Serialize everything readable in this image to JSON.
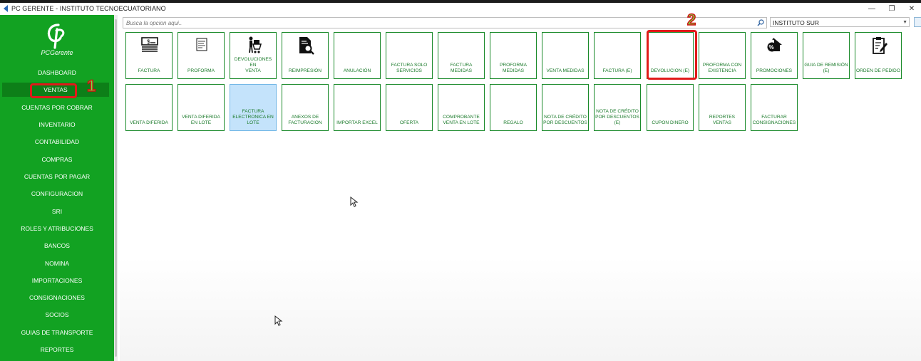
{
  "window": {
    "title": "PC GERENTE - INSTITUTO TECNOECUATORIANO",
    "controls": [
      "minimize-icon",
      "restore-icon",
      "close-icon"
    ]
  },
  "sidebar": {
    "logo_text": "PCGerente",
    "items": [
      {
        "label": "DASHBOARD",
        "active": false
      },
      {
        "label": "VENTAS",
        "active": true
      },
      {
        "label": "CUENTAS POR COBRAR",
        "active": false
      },
      {
        "label": "INVENTARIO",
        "active": false
      },
      {
        "label": "CONTABILIDAD",
        "active": false
      },
      {
        "label": "COMPRAS",
        "active": false
      },
      {
        "label": "CUENTAS POR PAGAR",
        "active": false
      },
      {
        "label": "CONFIGURACION",
        "active": false
      },
      {
        "label": "SRI",
        "active": false
      },
      {
        "label": "ROLES Y ATRIBUCIONES",
        "active": false
      },
      {
        "label": "BANCOS",
        "active": false
      },
      {
        "label": "NOMINA",
        "active": false
      },
      {
        "label": "IMPORTACIONES",
        "active": false
      },
      {
        "label": "CONSIGNACIONES",
        "active": false
      },
      {
        "label": "SOCIOS",
        "active": false
      },
      {
        "label": "GUIAS DE TRANSPORTE",
        "active": false
      },
      {
        "label": "REPORTES",
        "active": false
      }
    ]
  },
  "toolbar": {
    "search_placeholder": "Busca la opcion aqui..",
    "branch": "INSTITUTO SUR"
  },
  "tiles_row1": [
    {
      "label": "FACTURA",
      "icon": "invoice-icon"
    },
    {
      "label": "PROFORMA",
      "icon": "proforma-icon"
    },
    {
      "label": "DEVOLUCIONES EN\nVENTA",
      "icon": "return-cart-icon"
    },
    {
      "label": "REIMPRESIÓN",
      "icon": "document-search-icon"
    },
    {
      "label": "ANULACIÓN",
      "icon": ""
    },
    {
      "label": "FACTURA SOLO\nSERVICIOS",
      "icon": ""
    },
    {
      "label": "FACTURA MEDIDAS",
      "icon": ""
    },
    {
      "label": "PROFORMA\nMEDIDAS",
      "icon": ""
    },
    {
      "label": "VENTA MEDIDAS",
      "icon": ""
    },
    {
      "label": "FACTURA (E)",
      "icon": ""
    },
    {
      "label": "DEVOLUCION (E)",
      "icon": ""
    },
    {
      "label": "PROFORMA CON\nEXISTENCIA",
      "icon": ""
    },
    {
      "label": "PROMOCIONES",
      "icon": "promotion-house-icon"
    },
    {
      "label": "GUIA DE REMISIÓN\n(E)",
      "icon": ""
    },
    {
      "label": "ORDEN DE PEDIDO",
      "icon": "clipboard-edit-icon"
    }
  ],
  "tiles_row2": [
    {
      "label": "VENTA DIFERIDA",
      "selected": false
    },
    {
      "label": "VENTA DIFERIDA\nEN LOTE",
      "selected": false
    },
    {
      "label": "FACTURA\nELECTRONICA EN\nLOTE",
      "selected": true
    },
    {
      "label": "ANEXOS DE\nFACTURACION",
      "selected": false
    },
    {
      "label": "IMPORTAR EXCEL",
      "selected": false
    },
    {
      "label": "OFERTA",
      "selected": false
    },
    {
      "label": "COMPROBANTE\nVENTA EN LOTE",
      "selected": false
    },
    {
      "label": "REGALO",
      "selected": false
    },
    {
      "label": "NOTA DE CRÉDITO\nPOR DESCUENTOS",
      "selected": false
    },
    {
      "label": "NOTA DE CRÉDITO\nPOR DESCUENTOS\n(E)",
      "selected": false
    },
    {
      "label": "CUPON DINERO",
      "selected": false
    },
    {
      "label": "REPORTES VENTAS",
      "selected": false
    },
    {
      "label": "FACTURAR\nCONSIGNACIONES",
      "selected": false
    }
  ],
  "annotations": [
    {
      "number": "1",
      "target": "VENTAS",
      "color": "#e11a1a"
    },
    {
      "number": "2",
      "target": "DEVOLUCION (E)",
      "color": "#e11a1a"
    }
  ],
  "colors": {
    "sidebar": "#12a222",
    "sidebar_active": "#0d7f18",
    "tile_border": "#1a8a2a",
    "tile_text": "#1a7a2a",
    "tile_selected": "#c4e3fb",
    "annotation": "#e11a1a"
  }
}
